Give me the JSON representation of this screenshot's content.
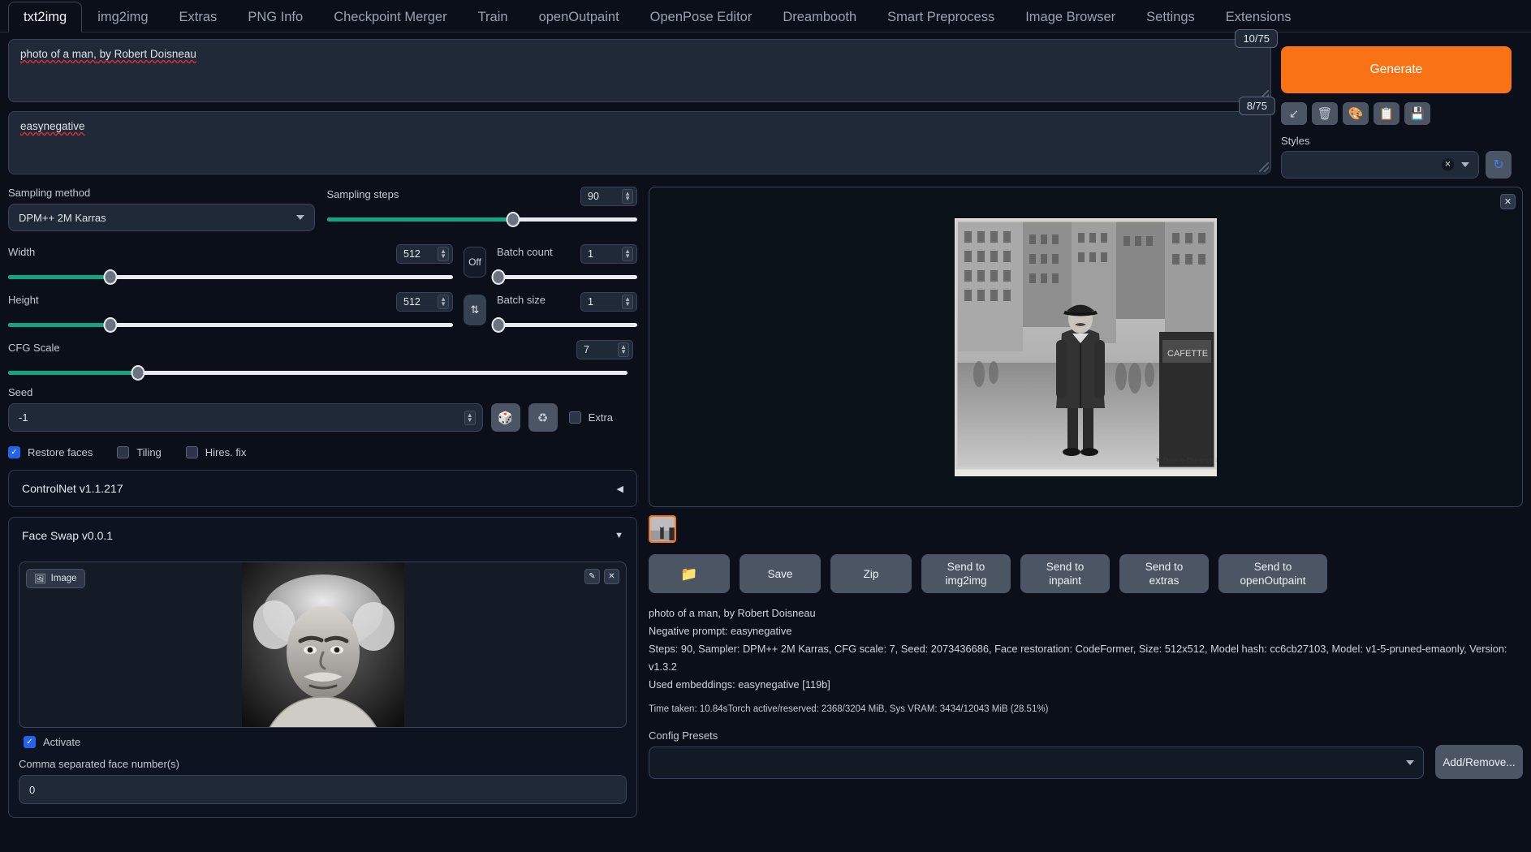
{
  "tabs": [
    {
      "label": "txt2img",
      "active": true
    },
    {
      "label": "img2img",
      "active": false
    },
    {
      "label": "Extras",
      "active": false
    },
    {
      "label": "PNG Info",
      "active": false
    },
    {
      "label": "Checkpoint Merger",
      "active": false
    },
    {
      "label": "Train",
      "active": false
    },
    {
      "label": "openOutpaint",
      "active": false
    },
    {
      "label": "OpenPose Editor",
      "active": false
    },
    {
      "label": "Dreambooth",
      "active": false
    },
    {
      "label": "Smart Preprocess",
      "active": false
    },
    {
      "label": "Image Browser",
      "active": false
    },
    {
      "label": "Settings",
      "active": false
    },
    {
      "label": "Extensions",
      "active": false
    }
  ],
  "prompt": {
    "positive_value": "photo of a man, by Robert Doisneau",
    "positive_part_a": "photo of a man,",
    "positive_part_b": " by Robert Doisneau",
    "positive_tokens": "10/75",
    "negative_value": "easynegative",
    "negative_tokens": "8/75"
  },
  "generate": {
    "label": "Generate",
    "color": "#f97316",
    "icons": [
      {
        "name": "arrow-down-left-icon",
        "glyph": "↙"
      },
      {
        "name": "trash-icon",
        "glyph": "🗑"
      },
      {
        "name": "palette-icon",
        "glyph": "🎨"
      },
      {
        "name": "clipboard-icon",
        "glyph": "📋"
      },
      {
        "name": "floppy-save-icon",
        "glyph": "💾"
      }
    ],
    "styles_label": "Styles",
    "styles_value": "",
    "refresh_icon": "↻"
  },
  "params": {
    "sampling_method_label": "Sampling method",
    "sampling_method_value": "DPM++ 2M Karras",
    "sampling_steps_label": "Sampling steps",
    "sampling_steps_value": "90",
    "sampling_steps_pct": 60,
    "width_label": "Width",
    "width_value": "512",
    "width_pct": 23,
    "height_label": "Height",
    "height_value": "512",
    "height_pct": 23,
    "batch_count_label": "Batch count",
    "batch_count_value": "1",
    "batch_count_pct": 0,
    "batch_size_label": "Batch size",
    "batch_size_value": "1",
    "batch_size_pct": 0,
    "cfg_label": "CFG Scale",
    "cfg_value": "7",
    "cfg_pct": 21,
    "off_label": "Off",
    "swap_icon": "⇅",
    "seed_label": "Seed",
    "seed_value": "-1",
    "dice_icon": "🎲",
    "recycle_icon": "♻",
    "extra_label": "Extra",
    "extra_checked": false,
    "restore_faces_label": "Restore faces",
    "restore_faces_checked": true,
    "tiling_label": "Tiling",
    "tiling_checked": false,
    "hires_label": "Hires. fix",
    "hires_checked": false
  },
  "controlnet": {
    "title": "ControlNet v1.1.217",
    "caret": "◀"
  },
  "faceswap": {
    "title": "Face Swap v0.0.1",
    "caret": "▼",
    "image_tag": "Image",
    "image_icon": "🖼",
    "edit_icon": "✎",
    "close_icon": "✕",
    "activate_label": "Activate",
    "activate_checked": true,
    "face_numbers_label": "Comma separated face number(s)",
    "face_numbers_value": "0"
  },
  "gallery": {
    "close_icon": "✕",
    "thumb_selected": true
  },
  "actions": {
    "folder_icon": "📁",
    "save_label": "Save",
    "zip_label": "Zip",
    "send_img2img_line1": "Send to",
    "send_img2img_line2": "img2img",
    "send_inpaint_line1": "Send to",
    "send_inpaint_line2": "inpaint",
    "send_extras_line1": "Send to",
    "send_extras_line2": "extras",
    "send_openoutpaint_line1": "Send to",
    "send_openoutpaint_line2": "openOutpaint"
  },
  "info": {
    "line1": "photo of a man, by Robert Doisneau",
    "line2": "Negative prompt: easynegative",
    "line3": "Steps: 90, Sampler: DPM++ 2M Karras, CFG scale: 7, Seed: 2073436686, Face restoration: CodeFormer, Size: 512x512, Model hash: cc6cb27103, Model: v1-5-pruned-emaonly, Version: v1.3.2",
    "line4": "Used embeddings: easynegative [119b]",
    "line5": "Time taken: 10.84sTorch active/reserved: 2368/3204 MiB, Sys VRAM: 3434/12043 MiB (28.51%)"
  },
  "presets": {
    "label": "Config Presets",
    "value": "",
    "add_remove_label": "Add/Remove..."
  }
}
